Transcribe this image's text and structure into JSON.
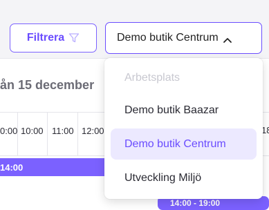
{
  "header": {
    "filter_label": "Filtrera",
    "store_selected": "Demo butik Centrum"
  },
  "schedule": {
    "date_label": "ån 15 december",
    "ticks": [
      "0:00",
      "10:00",
      "11:00",
      "12:00"
    ],
    "side_tick": "18",
    "shift_left_label": "14:00",
    "shift_right_label": "14:00 - 19:00"
  },
  "dropdown": {
    "options": [
      {
        "label": "Arbetsplats",
        "state": "disabled"
      },
      {
        "label": "Demo butik Baazar",
        "state": "normal"
      },
      {
        "label": "Demo butik Centrum",
        "state": "selected"
      },
      {
        "label": "Utveckling Miljö",
        "state": "normal"
      }
    ]
  },
  "colors": {
    "accent": "#6a4cff",
    "accent_fill": "#7b61ff",
    "selected_bg": "#ece9ff",
    "disabled_text": "#c8c8d0"
  },
  "icons": {
    "filter": "filter-funnel-icon",
    "chevron": "chevron-up-icon"
  }
}
